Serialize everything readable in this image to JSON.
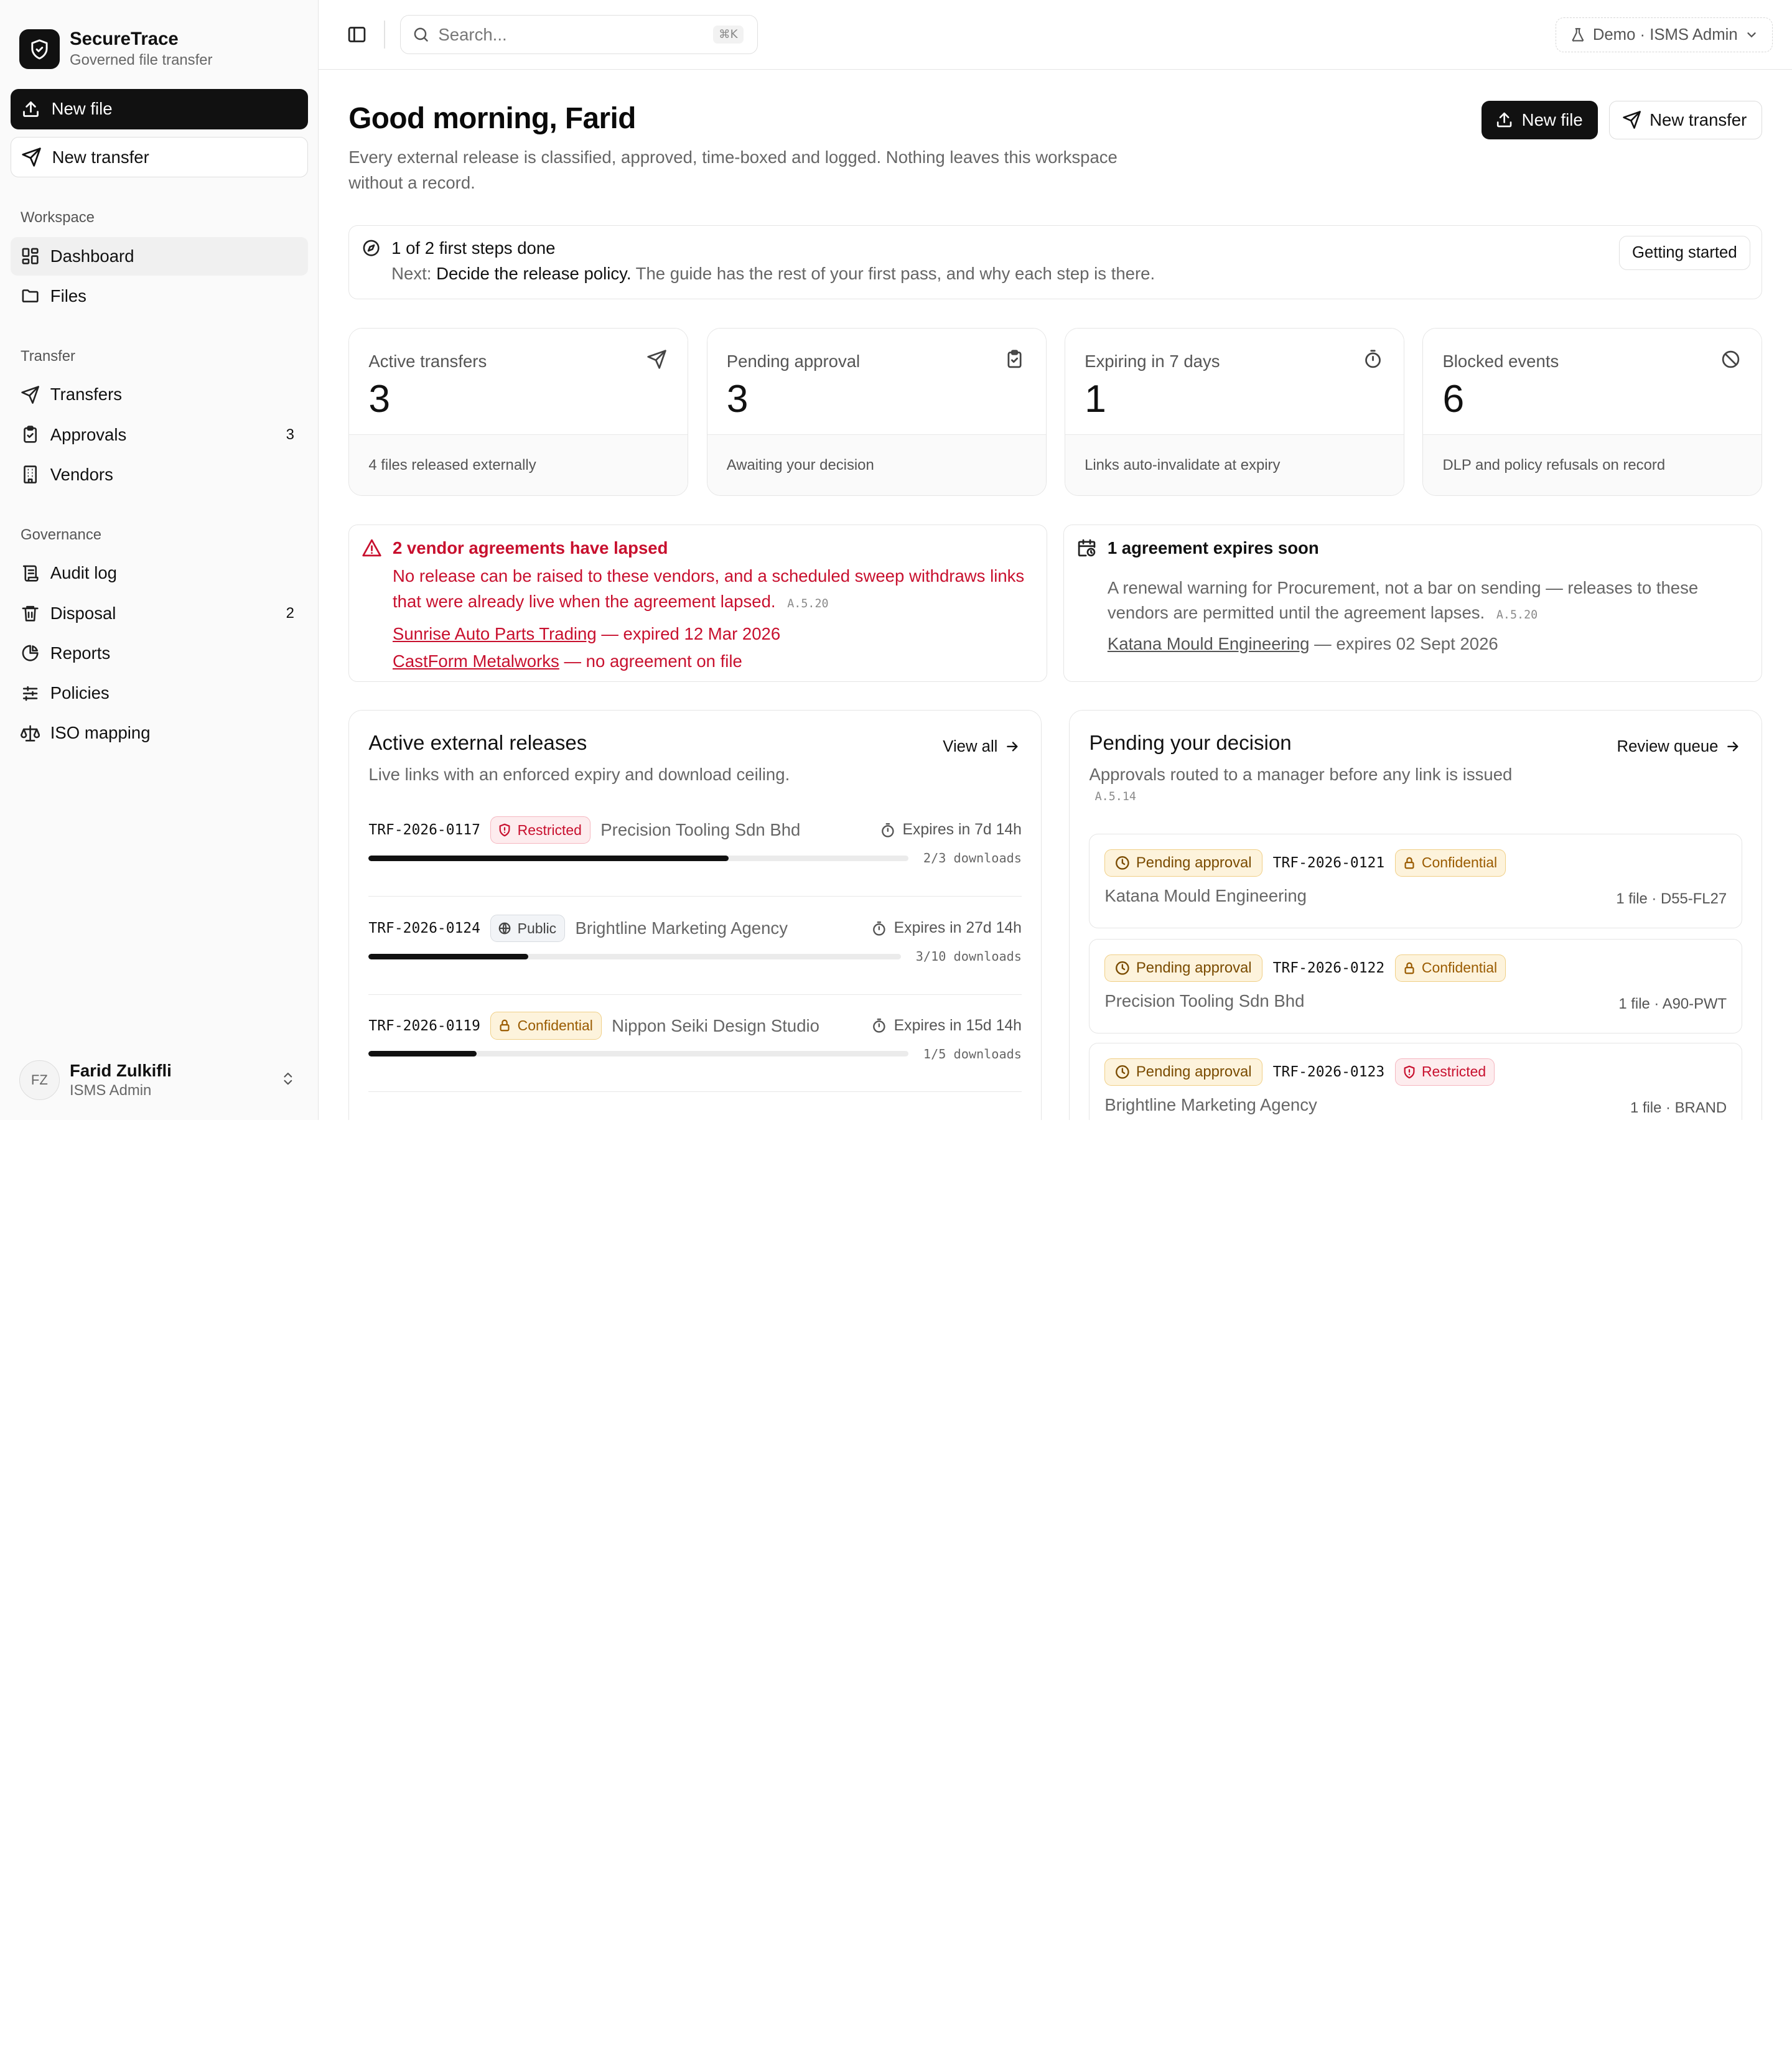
{
  "app": {
    "name": "SecureTrace",
    "tagline": "Governed file transfer"
  },
  "sidebar": {
    "new_file": "New file",
    "new_transfer": "New transfer",
    "sections": [
      {
        "label": "Workspace",
        "items": [
          {
            "label": "Dashboard",
            "icon": "dashboard-icon",
            "count": ""
          },
          {
            "label": "Files",
            "icon": "folder-icon",
            "count": ""
          }
        ]
      },
      {
        "label": "Transfer",
        "items": [
          {
            "label": "Transfers",
            "icon": "send-icon",
            "count": ""
          },
          {
            "label": "Approvals",
            "icon": "clipboard-check-icon",
            "count": "3"
          },
          {
            "label": "Vendors",
            "icon": "building-icon",
            "count": ""
          }
        ]
      },
      {
        "label": "Governance",
        "items": [
          {
            "label": "Audit log",
            "icon": "scroll-icon",
            "count": ""
          },
          {
            "label": "Disposal",
            "icon": "trash-icon",
            "count": "2"
          },
          {
            "label": "Reports",
            "icon": "chart-pie-icon",
            "count": ""
          },
          {
            "label": "Policies",
            "icon": "sliders-icon",
            "count": ""
          },
          {
            "label": "ISO mapping",
            "icon": "scale-icon",
            "count": ""
          }
        ]
      }
    ],
    "user": {
      "initials": "FZ",
      "name": "Farid Zulkifli",
      "role": "ISMS Admin"
    }
  },
  "topbar": {
    "search_placeholder": "Search...",
    "search_shortcut": "⌘K",
    "env_label": "Demo · ISMS Admin"
  },
  "header": {
    "greeting": "Good morning, Farid",
    "intro": "Every external release is classified, approved, time-boxed and logged. Nothing leaves this workspace without a record.",
    "new_file": "New file",
    "new_transfer": "New transfer"
  },
  "steps": {
    "title": "1 of 2 first steps done",
    "next_prefix": "Next:",
    "next_step": "Decide the release policy.",
    "next_suffix": "The guide has the rest of your first pass, and why each step is there.",
    "button": "Getting started"
  },
  "stats": [
    {
      "label": "Active transfers",
      "value": "3",
      "foot": "4 files released externally",
      "icon": "send-icon"
    },
    {
      "label": "Pending approval",
      "value": "3",
      "foot": "Awaiting your decision",
      "icon": "clipboard-check-icon"
    },
    {
      "label": "Expiring in 7 days",
      "value": "1",
      "foot": "Links auto-invalidate at expiry",
      "icon": "timer-icon"
    },
    {
      "label": "Blocked events",
      "value": "6",
      "foot": "DLP and policy refusals on record",
      "icon": "ban-icon"
    }
  ],
  "alerts": {
    "lapsed": {
      "title": "2 vendor agreements have lapsed",
      "body": "No release can be raised to these vendors, and a scheduled sweep withdraws links that were already live when the agreement lapsed.",
      "ref": "A.5.20",
      "lines": [
        {
          "vendor": "Sunrise Auto Parts Trading",
          "detail": "— expired 12 Mar 2026"
        },
        {
          "vendor": "CastForm Metalworks",
          "detail": "— no agreement on file"
        }
      ]
    },
    "expiring": {
      "title": "1 agreement expires soon",
      "body": "A renewal warning for Procurement, not a bar on sending — releases to these vendors are permitted until the agreement lapses.",
      "ref": "A.5.20",
      "lines": [
        {
          "vendor": "Katana Mould Engineering",
          "detail": "— expires 02 Sept 2026"
        }
      ]
    }
  },
  "releases": {
    "title": "Active external releases",
    "subtitle": "Live links with an enforced expiry and download ceiling.",
    "link": "View all",
    "items": [
      {
        "id": "TRF-2026-0117",
        "class": "Restricted",
        "class_key": "restricted",
        "vendor": "Precision Tooling Sdn Bhd",
        "expires": "Expires in 7d 14h",
        "downloads": "2/3 downloads",
        "progress": 0.667
      },
      {
        "id": "TRF-2026-0124",
        "class": "Public",
        "class_key": "public",
        "vendor": "Brightline Marketing Agency",
        "expires": "Expires in 27d 14h",
        "downloads": "3/10 downloads",
        "progress": 0.3
      },
      {
        "id": "TRF-2026-0119",
        "class": "Confidential",
        "class_key": "confidential",
        "vendor": "Nippon Seiki Design Studio",
        "expires": "Expires in 15d 14h",
        "downloads": "1/5 downloads",
        "progress": 0.2
      }
    ]
  },
  "pending": {
    "title": "Pending your decision",
    "subtitle": "Approvals routed to a manager before any link is issued",
    "ref": "A.5.14",
    "link": "Review queue",
    "items": [
      {
        "status": "Pending approval",
        "id": "TRF-2026-0121",
        "class": "Confidential",
        "class_key": "confidential",
        "vendor": "Katana Mould Engineering",
        "meta": "1 file · D55-FL27"
      },
      {
        "status": "Pending approval",
        "id": "TRF-2026-0122",
        "class": "Confidential",
        "class_key": "confidential",
        "vendor": "Precision Tooling Sdn Bhd",
        "meta": "1 file · A90-PWT"
      },
      {
        "status": "Pending approval",
        "id": "TRF-2026-0123",
        "class": "Restricted",
        "class_key": "restricted",
        "vendor": "Brightline Marketing Agency",
        "meta": "1 file · BRAND"
      }
    ]
  }
}
